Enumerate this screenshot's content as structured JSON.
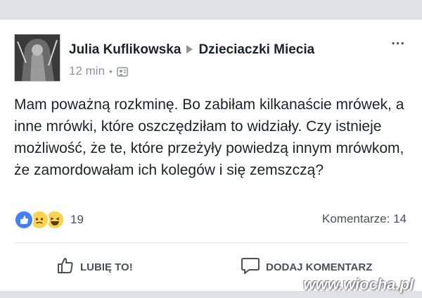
{
  "post": {
    "author": "Julia Kuflikowska",
    "group": "Dzieciaczki Miecia",
    "time": "12 min",
    "dot": "•",
    "more": "...",
    "text": "Mam poważną rozkminę. Bo zabiłam kilkanaście mrówek, a inne mrówki, które oszczędziłam to widziały. Czy istnieje możliwość, że te, które przeżyły powiedzą innym mrówkom, że zamordowałam ich kolegów i się zemszczą?"
  },
  "reactions": {
    "icons": [
      "like-icon",
      "sad-icon",
      "haha-icon"
    ],
    "count": "19",
    "comments": "Komentarze: 14"
  },
  "actions": {
    "like_label": "LUBIĘ TO!",
    "comment_label": "DODAJ KOMENTARZ"
  },
  "watermark": "www.wiocha.pl",
  "colors": {
    "background": "#dfe1e6",
    "card": "#ffffff",
    "like_blue": "#4080ff",
    "emoji_yellow": "#fcd34d"
  }
}
